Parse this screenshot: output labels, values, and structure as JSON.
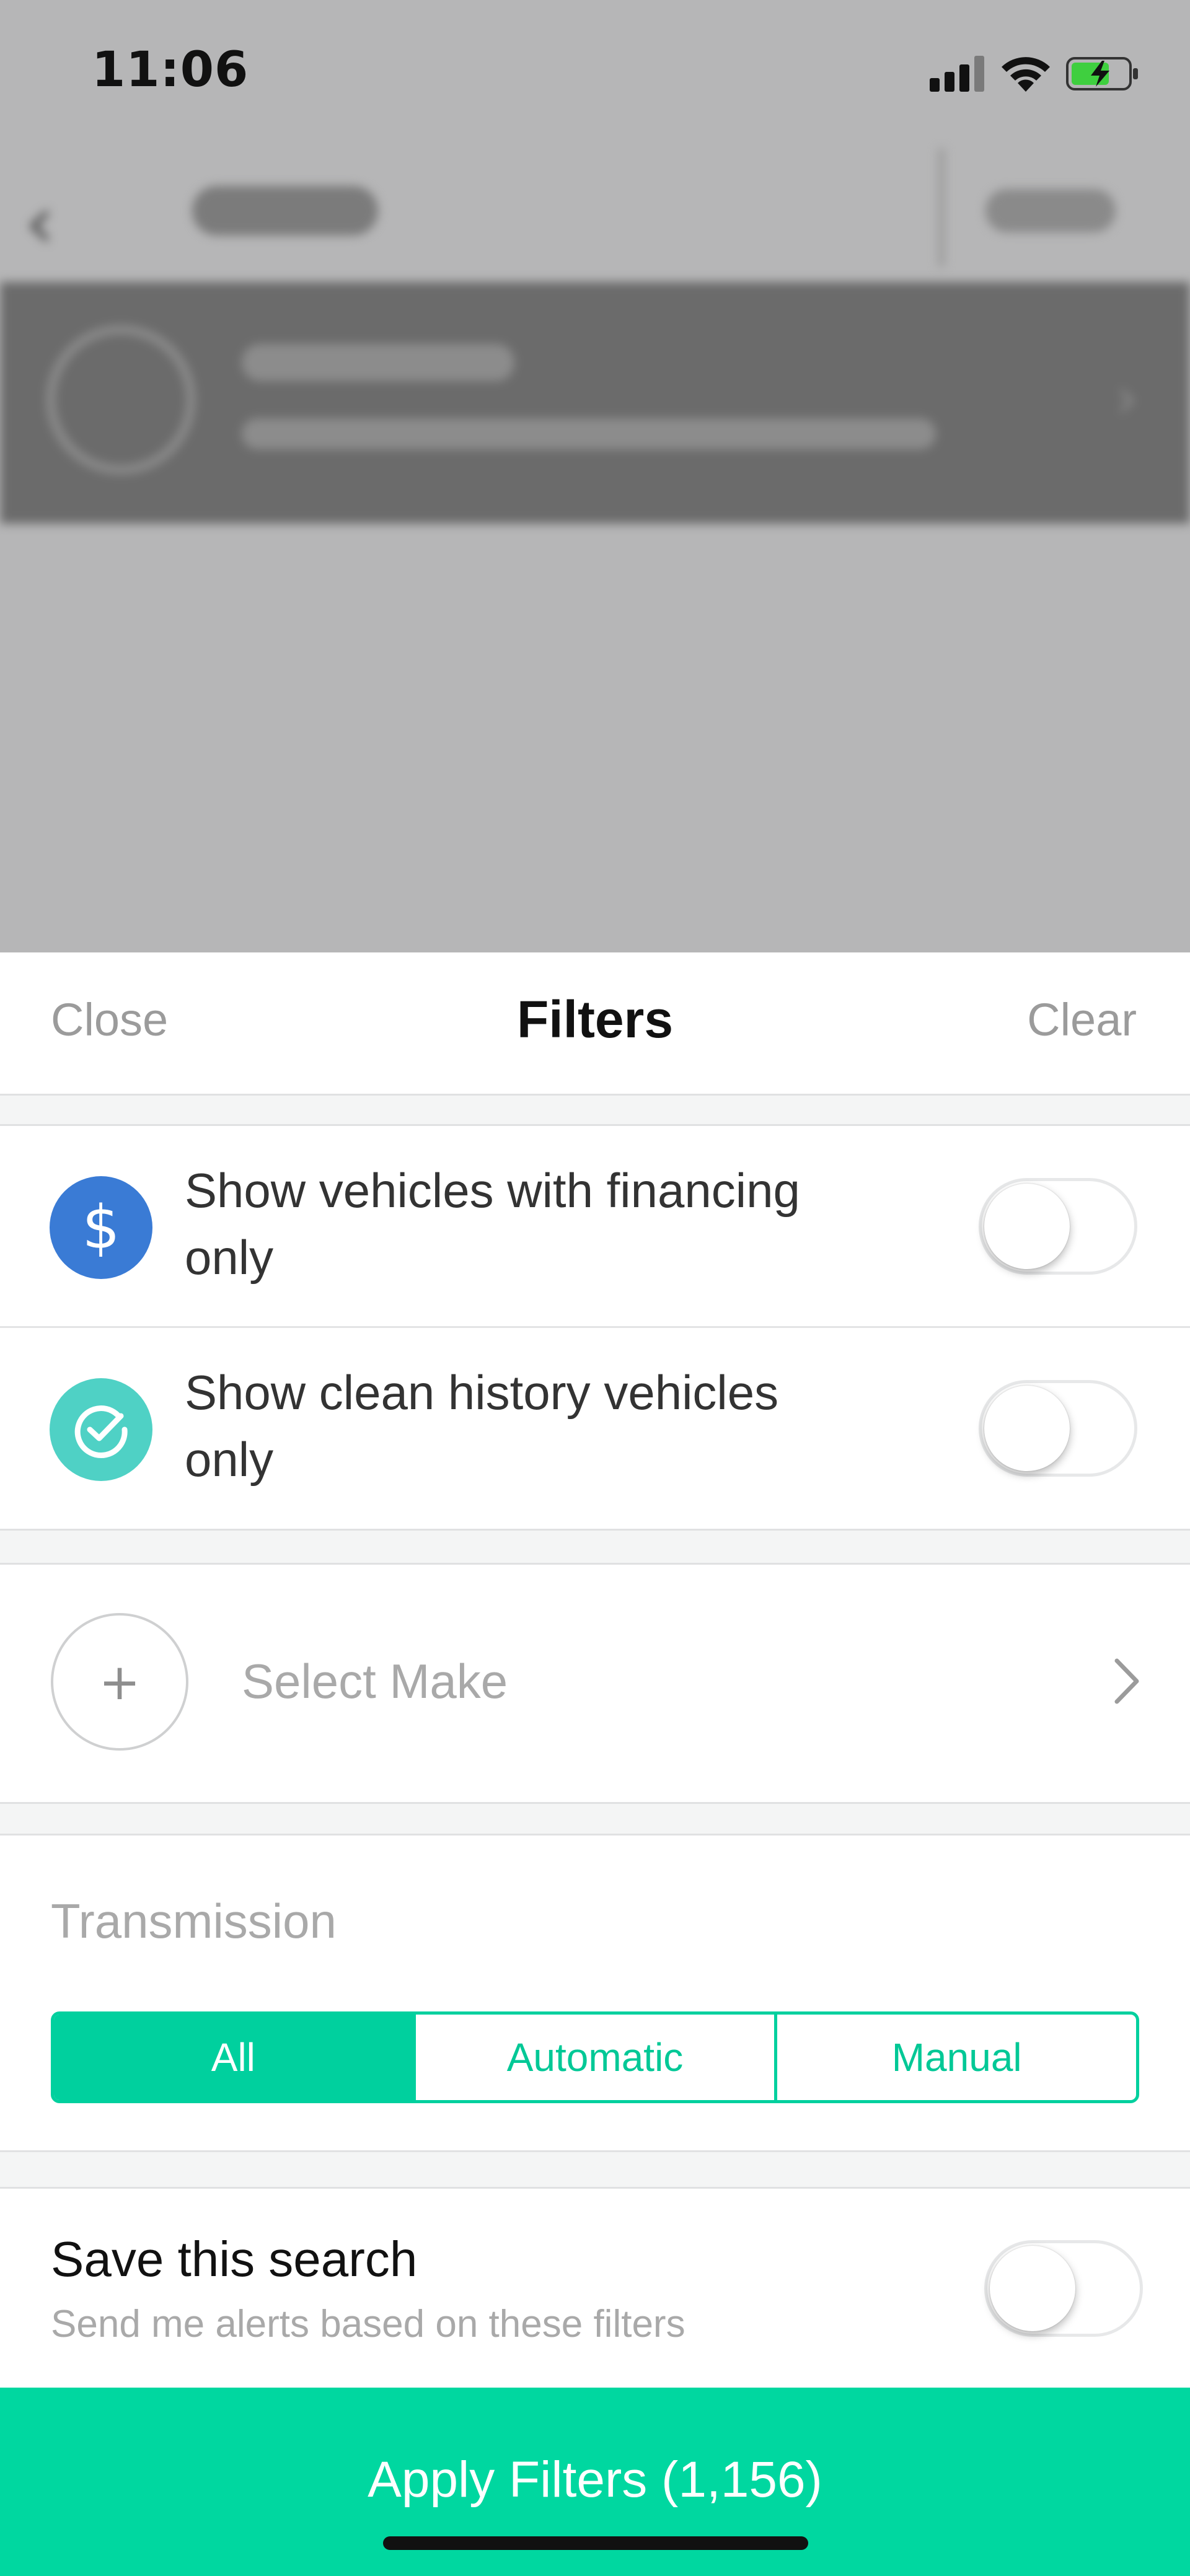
{
  "status_bar": {
    "time": "11:06",
    "icons": [
      "signal-icon",
      "wifi-icon",
      "battery-charging-icon"
    ]
  },
  "sheet": {
    "close_label": "Close",
    "title": "Filters",
    "clear_label": "Clear"
  },
  "toggles": {
    "financing": {
      "label": "Show vehicles with financing only",
      "icon": "dollar-icon",
      "icon_color": "#3a7bd5",
      "on": false
    },
    "clean_history": {
      "label": "Show clean history vehicles only",
      "icon": "check-badge-icon",
      "icon_color": "#4fd1c5",
      "on": false
    }
  },
  "make": {
    "icon": "plus-icon",
    "label": "Select Make"
  },
  "transmission": {
    "label": "Transmission",
    "options": [
      "All",
      "Automatic",
      "Manual"
    ],
    "selected": "All"
  },
  "save_search": {
    "title": "Save this search",
    "subtitle": "Send me alerts based on these filters",
    "on": false
  },
  "apply": {
    "label": "Apply Filters (1,156)"
  },
  "colors": {
    "accent": "#00d7a0",
    "overlay": "#b6b6b7"
  }
}
